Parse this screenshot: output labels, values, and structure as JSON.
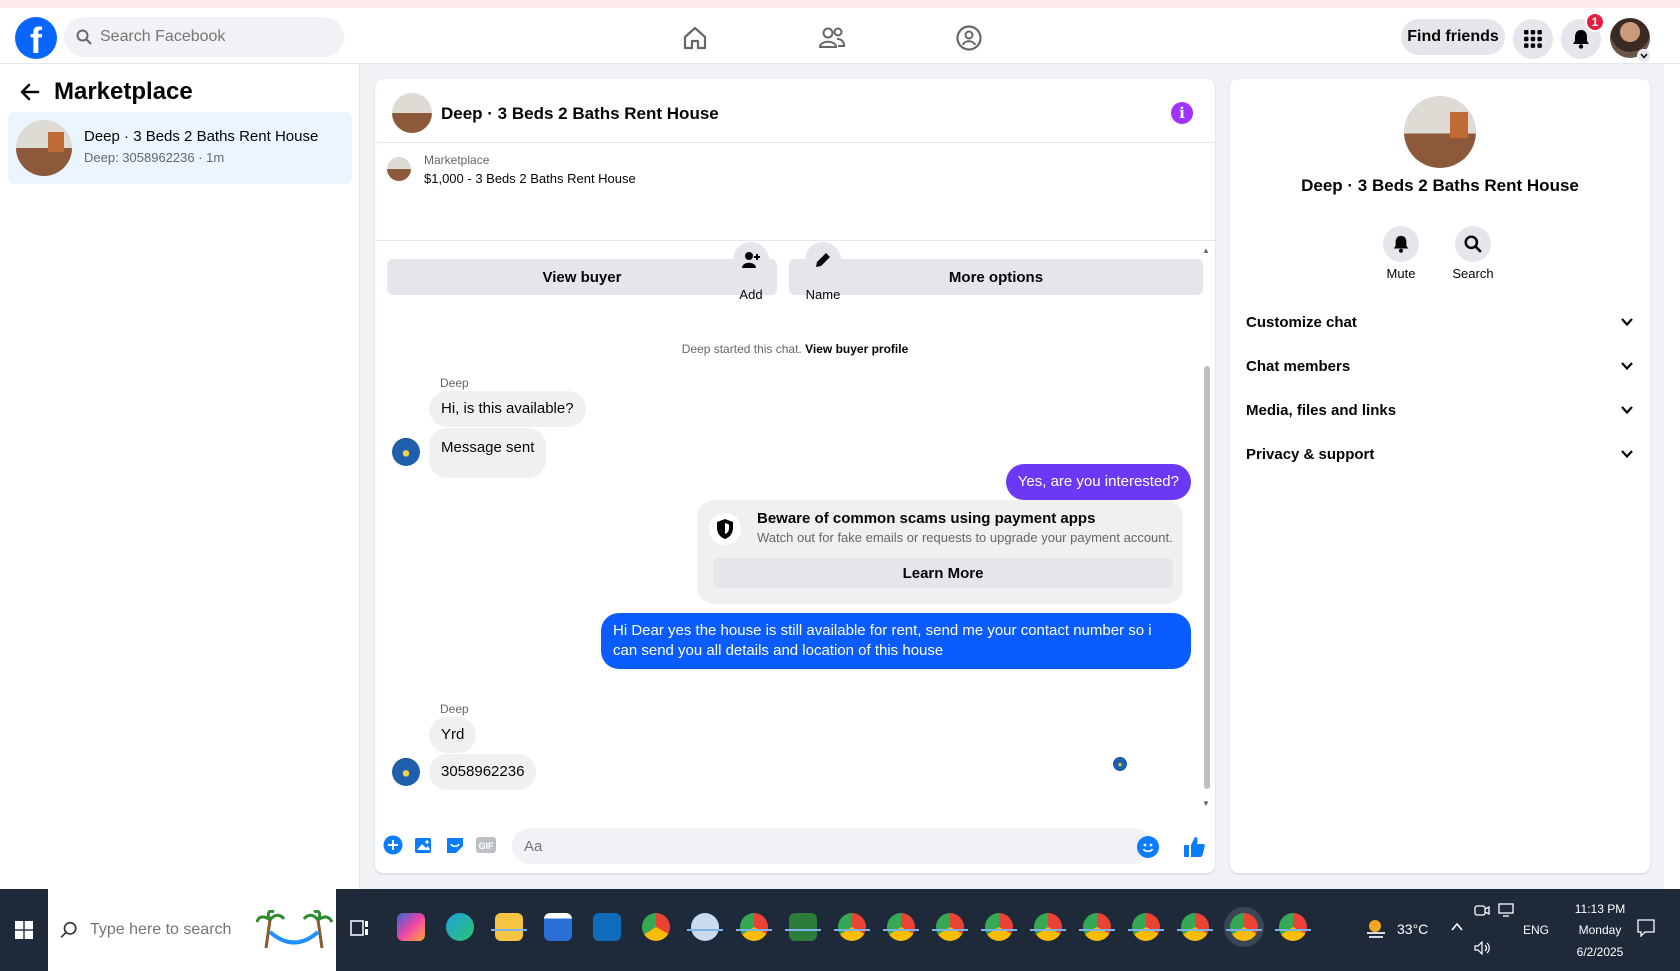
{
  "topbar": {
    "search_placeholder": "Search Facebook",
    "find_friends": "Find friends",
    "notification_count": "1"
  },
  "sidebar": {
    "title": "Marketplace",
    "conversation": {
      "name": "Deep · 3 Beds 2 Baths Rent House",
      "subtitle": "Deep: 3058962236 · 1m"
    }
  },
  "chat": {
    "title": "Deep · 3 Beds 2 Baths Rent House",
    "marketplace_label": "Marketplace",
    "listing": "$1,000 - 3 Beds 2 Baths Rent House",
    "view_buyer": "View buyer",
    "more_options": "More options",
    "add_label": "Add",
    "name_label": "Name",
    "system_text": "Deep started this chat.",
    "system_link": "View buyer profile",
    "messages": [
      {
        "sender": "Deep",
        "text": "Hi, is this available?"
      },
      {
        "text": "Message sent"
      },
      {
        "text": "Yes, are you interested?"
      },
      {
        "text": "Hi Dear yes the house is still available for rent, send me your contact number so i can send you all details and location of this house"
      },
      {
        "sender": "Deep",
        "text": "Yrd"
      },
      {
        "text": "3058962236"
      }
    ],
    "scam_card": {
      "title": "Beware of common scams using payment apps",
      "description": "Watch out for fake emails or requests to upgrade your payment account.",
      "button": "Learn More"
    },
    "composer_placeholder": "Aa"
  },
  "info_panel": {
    "name": "Deep · 3 Beds 2 Baths Rent House",
    "mute": "Mute",
    "search": "Search",
    "sections": [
      "Customize chat",
      "Chat members",
      "Media, files and links",
      "Privacy & support"
    ]
  },
  "taskbar": {
    "search_placeholder": "Type here to search",
    "weather": "33°C",
    "language": "ENG",
    "time": "11:13 PM",
    "day": "Monday",
    "date": "6/2/2025"
  },
  "colors": {
    "brand": "#0866ff",
    "outgoing_bubble": "#0a5cff",
    "outgoing_bubble_first": "#6b38f5",
    "info_icon": "#a033ff",
    "badge": "#e41e3f"
  }
}
